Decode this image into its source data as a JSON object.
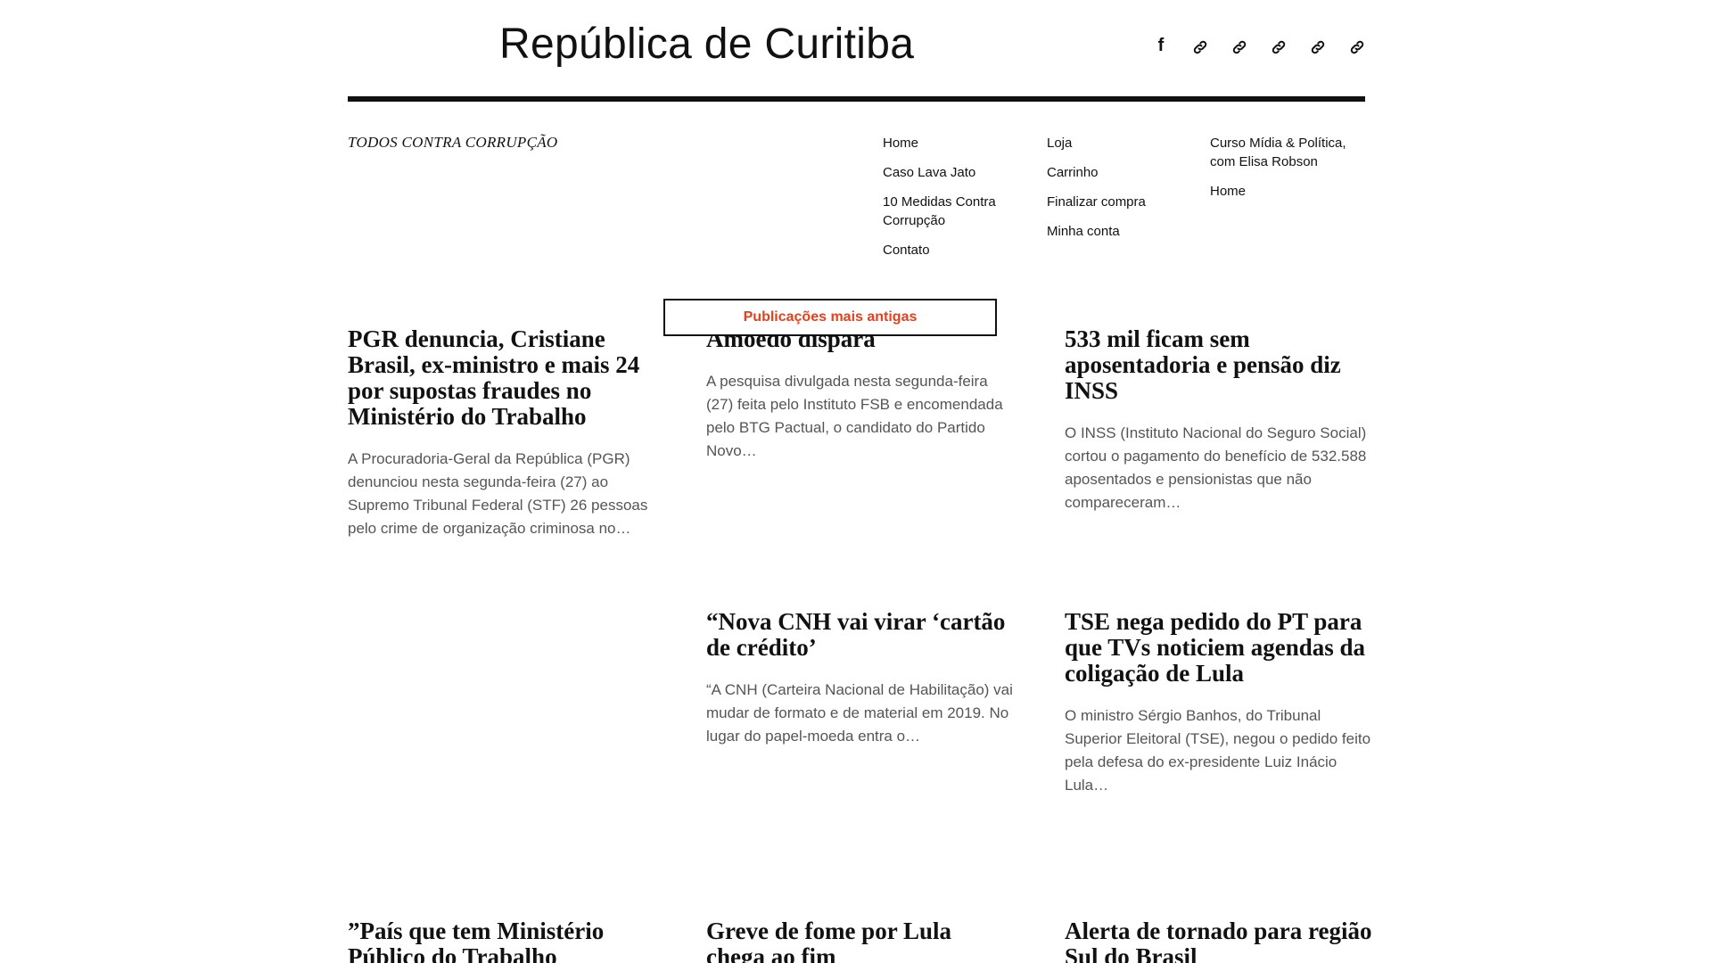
{
  "site": {
    "title": "República de Curitiba",
    "tagline": "TODOS CONTRA CORRUPÇÃO"
  },
  "social": [
    {
      "icon": "facebook-icon",
      "glyph": "f"
    },
    {
      "icon": "link-icon"
    },
    {
      "icon": "link-icon"
    },
    {
      "icon": "link-icon"
    },
    {
      "icon": "link-icon"
    },
    {
      "icon": "link-icon"
    }
  ],
  "nav": {
    "col1": [
      "Home",
      "Caso Lava Jato",
      "10 Medidas Contra Corrupção",
      "Contato"
    ],
    "col2": [
      "Loja",
      "Carrinho",
      "Finalizar compra",
      "Minha conta"
    ],
    "col3": [
      "Curso Mídia & Política, com Elisa Robson",
      "Home"
    ]
  },
  "older_posts_label": "Publicações mais antigas",
  "posts": [
    {
      "title": "PGR denuncia, Cristiane Brasil, ex-ministro e mais 24 por supostas fraudes no Ministério do Trabalho",
      "excerpt": "A Procuradoria-Geral da República (PGR) denunciou nesta segunda-feira (27) ao Supremo Tribunal Federal (STF) 26 pessoas pelo crime de organização criminosa no…"
    },
    {
      "title": "Amoêdo dispara",
      "excerpt": "A pesquisa divulgada nesta segunda-feira (27) feita pelo Instituto FSB e encomendada pelo BTG Pactual, o candidato do Partido Novo…"
    },
    {
      "title": "533 mil ficam sem aposentadoria e pensão diz INSS",
      "excerpt": "O INSS (Instituto Nacional do Seguro Social) cortou o pagamento do benefício de 532.588 aposentados e pensionistas que não compareceram…"
    },
    {
      "title": "“Nova CNH vai virar ‘cartão de crédito’",
      "excerpt": "“A CNH (Carteira Nacional de Habilitação) vai mudar de formato e de material em 2019. No lugar do papel-moeda entra o…"
    },
    {
      "title": "TSE nega pedido do PT para que TVs noticiem agendas da coligação de Lula",
      "excerpt": "O ministro Sérgio Banhos, do Tribunal Superior Eleitoral (TSE), negou o pedido feito pela defesa do ex-presidente Luiz Inácio Lula…"
    },
    {
      "title": "”País que tem Ministério Público do Trabalho",
      "excerpt": ""
    },
    {
      "title": "Greve de fome por Lula chega ao fim",
      "excerpt": ""
    },
    {
      "title": "Alerta de tornado para região Sul do Brasil",
      "excerpt": ""
    }
  ]
}
